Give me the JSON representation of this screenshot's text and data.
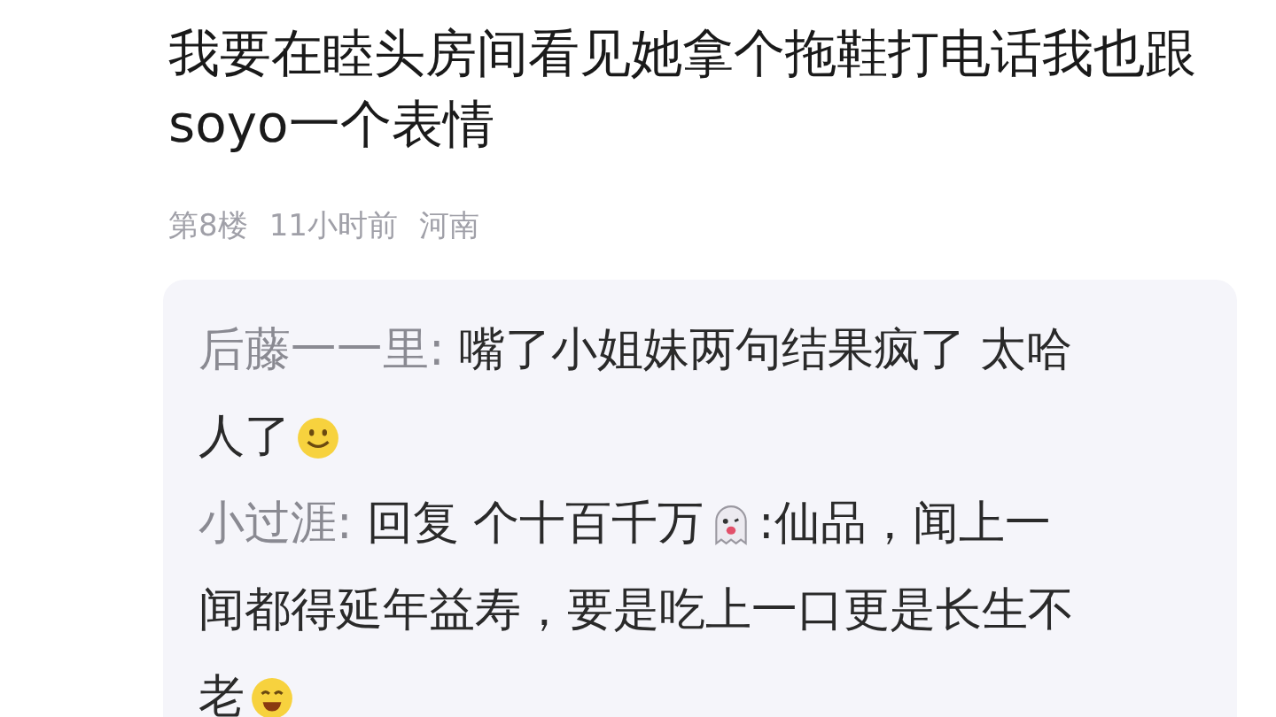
{
  "post": {
    "text": "我要在睦头房间看见她拿个拖鞋打电话我也跟soyo一个表情",
    "floor": "第8楼",
    "time": "11小时前",
    "location": "河南"
  },
  "replies": [
    {
      "author": "后藤一一里:",
      "lines": [
        [
          {
            "kind": "text",
            "text": "嘴了小姐妹两句结果疯了 太哈"
          }
        ],
        [
          {
            "kind": "text",
            "text": "人了"
          },
          {
            "kind": "smile"
          }
        ]
      ]
    },
    {
      "author": "小过涯:",
      "lines": [
        [
          {
            "kind": "text",
            "text": "回复 个十百千万"
          },
          {
            "kind": "ghost"
          },
          {
            "kind": "text",
            "text": ":仙品，闻上一"
          }
        ],
        [
          {
            "kind": "text",
            "text": "闻都得延年益寿，要是吃上一口更是长生不"
          }
        ],
        [
          {
            "kind": "text",
            "text": "老"
          },
          {
            "kind": "grin"
          }
        ]
      ]
    }
  ]
}
